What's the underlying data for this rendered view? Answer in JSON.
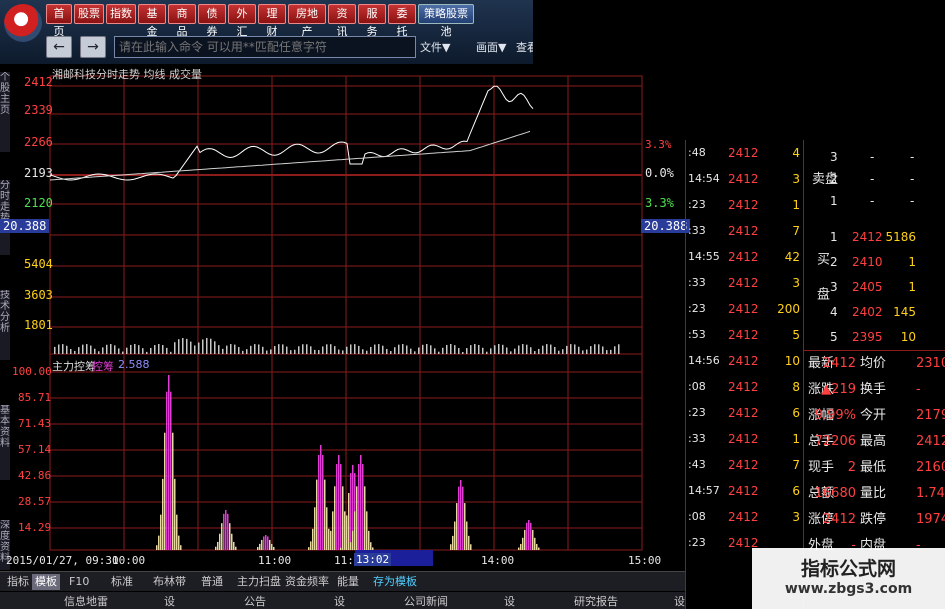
{
  "toolbar": {
    "menu": [
      "首页",
      "股票",
      "指数",
      "基金",
      "商品",
      "债券",
      "外汇",
      "理财",
      "房地产",
      "资讯",
      "服务",
      "委托",
      "策略股票池"
    ],
    "back_icon": "arrow-left-icon",
    "forward_icon": "arrow-right-icon",
    "command_placeholder": "请在此输入命令 可以用**匹配任意字符",
    "links": [
      "文件▼",
      "画面▼",
      "查看"
    ]
  },
  "left_tabs": [
    "个股主页",
    "分时走势",
    "技术分析",
    "基本资料",
    "深度资料"
  ],
  "chart": {
    "price_pane_title": "湘邮科技分时走势 均线 成交量",
    "price_ticks": [
      "2412",
      "2339",
      "2266",
      "2193",
      "2120"
    ],
    "price_cursor": "20.388",
    "pct_ticks": [
      "3.3%",
      "0.0%",
      "3.3%"
    ],
    "pct_cursor": "20.388",
    "volume_ticks": [
      "5404",
      "3603",
      "1801"
    ],
    "indicator_title": "主力控筹",
    "indicator_badge": "控筹",
    "indicator_value": "2.588",
    "indicator_ticks": [
      "100.00",
      "85.71",
      "71.43",
      "57.14",
      "42.86",
      "28.57",
      "14.29"
    ],
    "time_labels": [
      "2015/01/27, 09:30",
      "10:00",
      "11:00",
      "11:3",
      "13:02",
      "14:00",
      "15:00"
    ],
    "colors": {
      "grid": "#8c1b1b",
      "price": "#ffffff",
      "avg": "#d0d0d0",
      "volume": "#c8c8c8",
      "indicator": "#e8d9a0",
      "highlight": "#e23bd6"
    }
  },
  "ticks": [
    {
      "time": ":48",
      "price": "2412",
      "vol": "4"
    },
    {
      "time": "14:54",
      "price": "2412",
      "vol": "3"
    },
    {
      "time": ":23",
      "price": "2412",
      "vol": "1"
    },
    {
      "time": ":33",
      "price": "2412",
      "vol": "7"
    },
    {
      "time": "14:55",
      "price": "2412",
      "vol": "42"
    },
    {
      "time": ":33",
      "price": "2412",
      "vol": "3"
    },
    {
      "time": ":23",
      "price": "2412",
      "vol": "200"
    },
    {
      "time": ":53",
      "price": "2412",
      "vol": "5"
    },
    {
      "time": "14:56",
      "price": "2412",
      "vol": "10"
    },
    {
      "time": ":08",
      "price": "2412",
      "vol": "8"
    },
    {
      "time": ":23",
      "price": "2412",
      "vol": "6"
    },
    {
      "time": ":33",
      "price": "2412",
      "vol": "1"
    },
    {
      "time": ":43",
      "price": "2412",
      "vol": "7"
    },
    {
      "time": "14:57",
      "price": "2412",
      "vol": "6"
    },
    {
      "time": ":08",
      "price": "2412",
      "vol": "3"
    },
    {
      "time": ":23",
      "price": "2412",
      "vol": ""
    }
  ],
  "orderbook": {
    "sell_label": "卖盘",
    "buy_label": "买盘",
    "sell": [
      {
        "n": "3",
        "price": "-",
        "qty": "-"
      },
      {
        "n": "2",
        "price": "-",
        "qty": "-"
      },
      {
        "n": "1",
        "price": "-",
        "qty": "-"
      }
    ],
    "buy": [
      {
        "n": "1",
        "price": "2412",
        "qty": "5186"
      },
      {
        "n": "2",
        "price": "2410",
        "qty": "1"
      },
      {
        "n": "3",
        "price": "2405",
        "qty": "1"
      },
      {
        "n": "4",
        "price": "2402",
        "qty": "145"
      },
      {
        "n": "5",
        "price": "2395",
        "qty": "10"
      }
    ]
  },
  "quote": [
    {
      "l1": "最新",
      "v1": "2412",
      "l2": "均价",
      "v2": "2310"
    },
    {
      "l1": "涨跌",
      "v1": "▲219",
      "l2": "换手",
      "v2": "-"
    },
    {
      "l1": "涨幅",
      "v1": "9.99%",
      "l2": "今开",
      "v2": "2179"
    },
    {
      "l1": "总手",
      "v1": "72206",
      "l2": "最高",
      "v2": "2412"
    },
    {
      "l1": "现手",
      "v1": "2",
      "l2": "最低",
      "v2": "2160"
    },
    {
      "l1": "总额",
      "v1": "16680",
      "l2": "量比",
      "v2": "1.74"
    },
    {
      "l1": "涨停",
      "v1": "2412",
      "l2": "跌停",
      "v2": "1974"
    },
    {
      "l1": "外盘",
      "v1": "-",
      "l2": "内盘",
      "v2": "-"
    }
  ],
  "bottom_tabs": [
    "指标",
    "模板",
    "F10",
    "标准",
    "布林带",
    "普通",
    "主力扫盘",
    "资金频率",
    "能量",
    "存为模板"
  ],
  "info_tabs": [
    "信息地雷",
    "设",
    "公告",
    "设",
    "公司新闻",
    "设",
    "研究报告",
    "设"
  ],
  "watermark": {
    "title": "指标公式网",
    "url": "www.zbgs3.com"
  }
}
